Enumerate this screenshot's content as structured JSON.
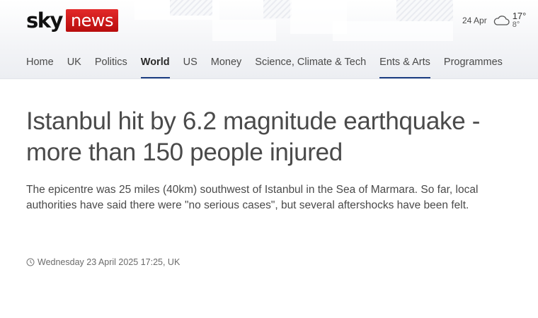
{
  "brand": {
    "sky": "sky",
    "news": "news",
    "accent": "#c8101a"
  },
  "weather": {
    "date": "24 Apr",
    "icon": "cloud-icon",
    "high": "17°",
    "low": "8°"
  },
  "nav": {
    "items": [
      {
        "label": "Home"
      },
      {
        "label": "UK"
      },
      {
        "label": "Politics"
      },
      {
        "label": "World",
        "active": true
      },
      {
        "label": "US"
      },
      {
        "label": "Money"
      },
      {
        "label": "Science, Climate & Tech"
      },
      {
        "label": "Ents & Arts",
        "underlined": true
      },
      {
        "label": "Programmes"
      }
    ],
    "active_color": "#1c3e82"
  },
  "article": {
    "headline": "Istanbul hit by 6.2 magnitude earthquake - more than 150 people injured",
    "standfirst": "The epicentre was 25 miles (40km) southwest of Istanbul in the Sea of Marmara. So far, local authorities have said there were \"no serious cases\", but several aftershocks have been felt.",
    "timestamp": "Wednesday 23 April 2025 17:25, UK"
  }
}
